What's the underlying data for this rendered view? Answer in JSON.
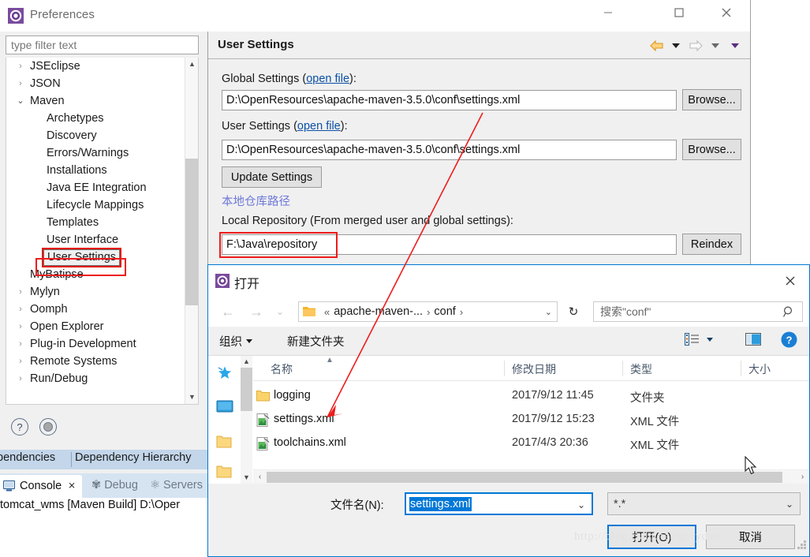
{
  "preferences": {
    "title": "Preferences",
    "icon": "gear-icon",
    "window_controls": {
      "minimize": "minimize-icon",
      "maximize": "maximize-icon",
      "close": "close-icon"
    },
    "filter_placeholder": "type filter text",
    "tree": [
      {
        "label": "JSEclipse",
        "depth": 0,
        "arrow": "collapsed"
      },
      {
        "label": "JSON",
        "depth": 0,
        "arrow": "collapsed"
      },
      {
        "label": "Maven",
        "depth": 0,
        "arrow": "expanded"
      },
      {
        "label": "Archetypes",
        "depth": 1,
        "arrow": "none"
      },
      {
        "label": "Discovery",
        "depth": 1,
        "arrow": "none"
      },
      {
        "label": "Errors/Warnings",
        "depth": 1,
        "arrow": "none"
      },
      {
        "label": "Installations",
        "depth": 1,
        "arrow": "none"
      },
      {
        "label": "Java EE Integration",
        "depth": 1,
        "arrow": "none"
      },
      {
        "label": "Lifecycle Mappings",
        "depth": 1,
        "arrow": "none"
      },
      {
        "label": "Templates",
        "depth": 1,
        "arrow": "none"
      },
      {
        "label": "User Interface",
        "depth": 1,
        "arrow": "none"
      },
      {
        "label": "User Settings",
        "depth": 1,
        "arrow": "none",
        "selected": true
      },
      {
        "label": "MyBatipse",
        "depth": 0,
        "arrow": "none"
      },
      {
        "label": "Mylyn",
        "depth": 0,
        "arrow": "collapsed"
      },
      {
        "label": "Oomph",
        "depth": 0,
        "arrow": "collapsed"
      },
      {
        "label": "Open Explorer",
        "depth": 0,
        "arrow": "collapsed"
      },
      {
        "label": "Plug-in Development",
        "depth": 0,
        "arrow": "collapsed"
      },
      {
        "label": "Remote Systems",
        "depth": 0,
        "arrow": "collapsed"
      },
      {
        "label": "Run/Debug",
        "depth": 0,
        "arrow": "collapsed"
      }
    ],
    "bottom_buttons": {
      "help": "?",
      "restore_defaults": "restore-icon"
    }
  },
  "settings": {
    "title": "User Settings",
    "nav": {
      "back": "back-arrow-icon",
      "forward": "forward-arrow-icon"
    },
    "global_settings_label": "Global Settings (",
    "global_settings_link": "open file",
    "global_settings_label_end": "):",
    "global_settings_value": "D:\\OpenResources\\apache-maven-3.5.0\\conf\\settings.xml",
    "user_settings_label": "User Settings (",
    "user_settings_link": "open file",
    "user_settings_label_end": "):",
    "user_settings_value": "D:\\OpenResources\\apache-maven-3.5.0\\conf\\settings.xml",
    "browse_label": "Browse...",
    "update_settings_label": "Update Settings",
    "chinese_note": "本地仓库路径",
    "local_repo_label": "Local Repository (From merged user and global settings):",
    "local_repo_value": "F:\\Java\\repository",
    "reindex_label": "Reindex",
    "highlight_color": "#ee1c1c",
    "link_color": "#0b50a5",
    "note_color": "#6e78d8"
  },
  "open_dialog": {
    "title": "打开",
    "icon": "gear-icon",
    "close": "close-icon",
    "breadcrumb": {
      "prefix": "«",
      "segments": [
        "apache-maven-...",
        "conf"
      ]
    },
    "refresh": "refresh-icon",
    "search_placeholder": "搜索\"conf\"",
    "toolbar": {
      "organize": "组织",
      "new_folder": "新建文件夹",
      "view_icon": "view-list-icon",
      "pane_icon": "preview-pane-icon",
      "help_icon": "help-icon"
    },
    "columns": [
      "名称",
      "修改日期",
      "类型",
      "大小"
    ],
    "files": [
      {
        "name": "logging",
        "date": "2017/9/12 11:45",
        "type": "文件夹",
        "icon": "folder-icon"
      },
      {
        "name": "settings.xml",
        "date": "2017/9/12 15:23",
        "type": "XML 文件",
        "icon": "xml-file-icon"
      },
      {
        "name": "toolchains.xml",
        "date": "2017/4/3 20:36",
        "type": "XML 文件",
        "icon": "xml-file-icon"
      }
    ],
    "places": [
      "favorites-star-icon",
      "desktop-icon",
      "folder-icon",
      "folder-icon"
    ],
    "filename_label": "文件名(N):",
    "filename_value": "settings.xml",
    "filetype_value": "*.*",
    "open_button": "打开(O)",
    "cancel_button": "取消"
  },
  "eclipse_views": {
    "dependency_tabs": [
      "pendencies",
      "Dependency Hierarchy"
    ],
    "console_tab": "Console",
    "console_close": "✕",
    "other_tabs": [
      "Debug",
      "Servers"
    ],
    "console_line": "tomcat_wms [Maven Build] D:\\Oper"
  },
  "watermark": "http://blog.csdn.net/qz1ydao"
}
